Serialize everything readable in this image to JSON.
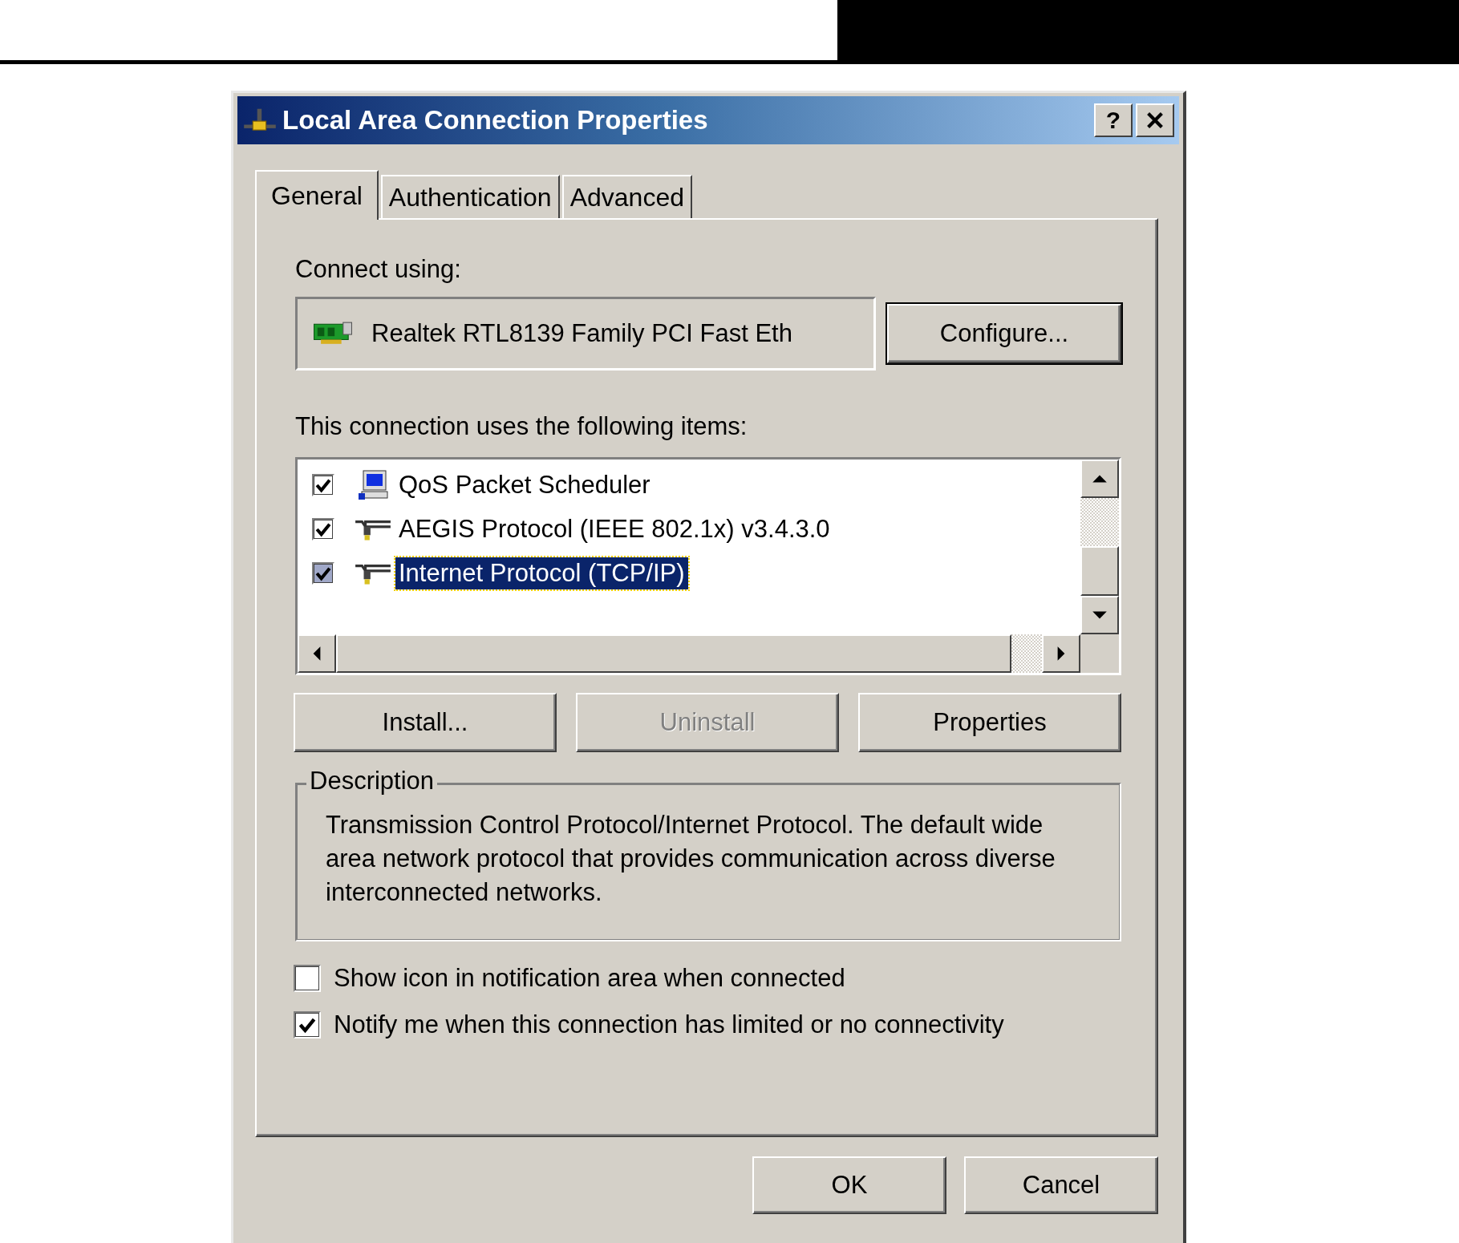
{
  "window": {
    "title": "Local Area Connection Properties",
    "help_button": "?"
  },
  "tabs": [
    {
      "label": "General",
      "selected": true
    },
    {
      "label": "Authentication",
      "selected": false
    },
    {
      "label": "Advanced",
      "selected": false
    }
  ],
  "connect_using": {
    "label": "Connect using:",
    "adapter": "Realtek RTL8139 Family PCI Fast Eth",
    "configure_button": "Configure..."
  },
  "items": {
    "label": "This connection uses the following items:",
    "list": [
      {
        "name": "QoS Packet Scheduler",
        "kind": "service",
        "checked": true,
        "selected": false
      },
      {
        "name": "AEGIS Protocol (IEEE 802.1x) v3.4.3.0",
        "kind": "protocol",
        "checked": true,
        "selected": false
      },
      {
        "name": "Internet Protocol (TCP/IP)",
        "kind": "protocol",
        "checked": true,
        "selected": true
      }
    ]
  },
  "item_buttons": [
    {
      "label": "Install...",
      "disabled": false
    },
    {
      "label": "Uninstall",
      "disabled": true
    },
    {
      "label": "Properties",
      "disabled": false
    }
  ],
  "description": {
    "label": "Description",
    "text": "Transmission Control Protocol/Internet Protocol. The default wide area network protocol that provides communication across diverse interconnected networks."
  },
  "options": [
    {
      "label": "Show icon in notification area when connected",
      "checked": false
    },
    {
      "label": "Notify me when this connection has limited or no connectivity",
      "checked": true
    }
  ],
  "buttons": [
    "OK",
    "Cancel"
  ]
}
